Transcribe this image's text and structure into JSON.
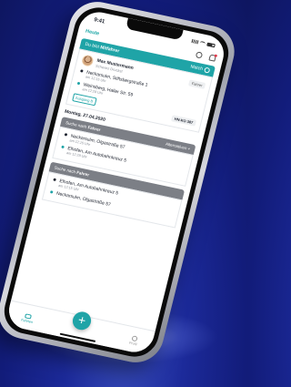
{
  "status": {
    "time": "9:41"
  },
  "header": {
    "title": "Heute",
    "icons": [
      "clock-icon",
      "bell-icon"
    ]
  },
  "match_card": {
    "banner_prefix": "Du bist ",
    "banner_role": "Mitfahrer",
    "match_label": "Match",
    "person_name": "Max Mustermann",
    "person_sub": "Schwarz Druckst",
    "person_role": "Fahrer",
    "stops": [
      {
        "name": "Neckarsulm, Stiftsbergstraße 1",
        "time": "am 12:15 Uhr"
      },
      {
        "name": "Weinsberg, Haller Str. 59",
        "time": "am 12:28 Uhr"
      }
    ],
    "tag": "Ausgang B",
    "plate": "HN-KO 387"
  },
  "date_heading": "Montag, 27.04.2020",
  "search_cards": [
    {
      "banner_prefix": "Suche nach ",
      "banner_role": "Fahrer",
      "action": "Alternativen",
      "stops": [
        {
          "name": "Neckarsulm, Olgastraße 57",
          "time": "am 12:15 Uhr"
        },
        {
          "name": "Elhofen, Am Autobahnkreuz 5",
          "time": "am 12:28 Uhr"
        }
      ]
    },
    {
      "banner_prefix": "Suche nach ",
      "banner_role": "Fahrer",
      "action": "",
      "stops": [
        {
          "name": "Elhofen, Am Autobahnkreuz 5",
          "time": "am 12:15 Uhr"
        },
        {
          "name": "Neckarsulm, Olgastraße 57",
          "time": ""
        }
      ]
    }
  ],
  "tabbar": {
    "left": "Fahrten",
    "center": "+",
    "right": "Profil"
  },
  "colors": {
    "accent": "#1fa4a7",
    "background": "#1c2a9a",
    "banner_gray": "#7c7f86"
  }
}
